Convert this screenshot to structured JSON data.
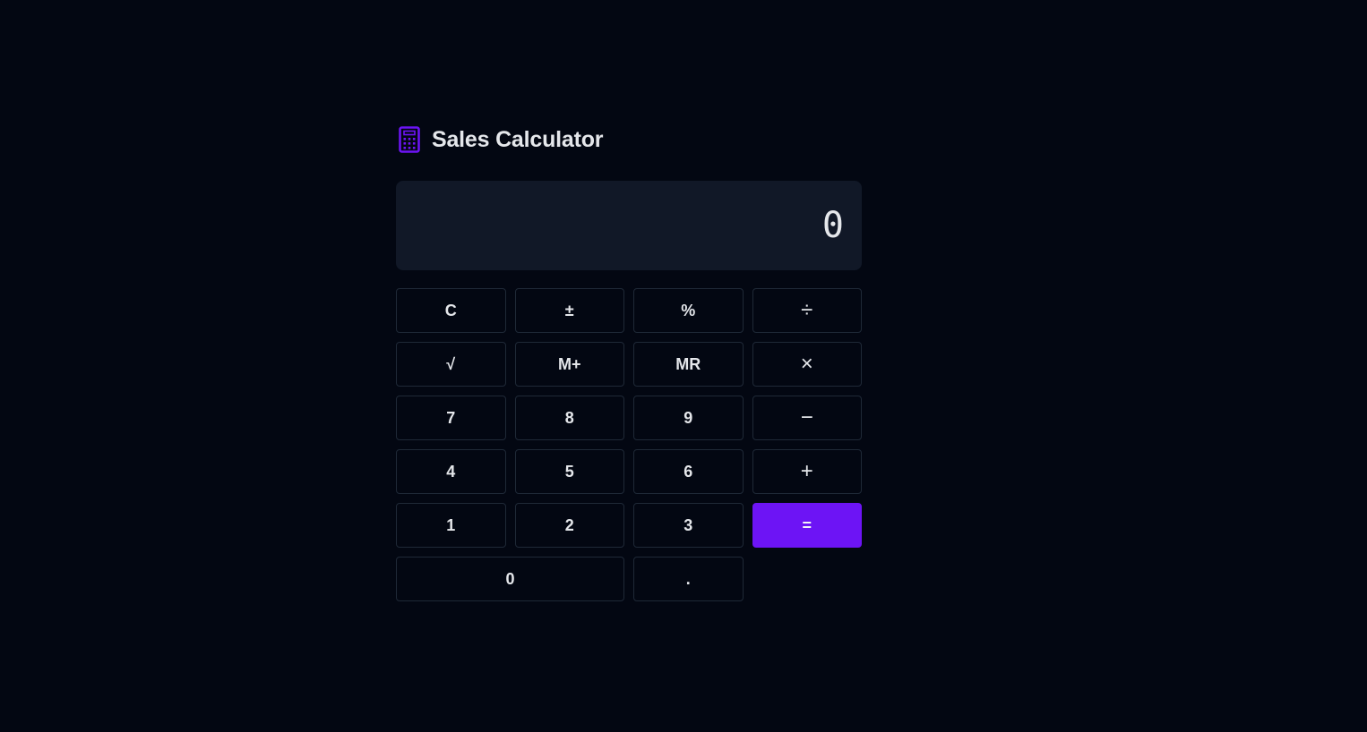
{
  "header": {
    "icon": "calculator-icon",
    "title": "Sales Calculator"
  },
  "display": {
    "value": "0"
  },
  "keys": {
    "clear": "C",
    "plus_minus": "±",
    "percent": "%",
    "divide": "÷",
    "sqrt": "√",
    "memory_add": "M+",
    "memory_recall": "MR",
    "multiply": "×",
    "seven": "7",
    "eight": "8",
    "nine": "9",
    "subtract": "−",
    "four": "4",
    "five": "5",
    "six": "6",
    "add": "+",
    "one": "1",
    "two": "2",
    "three": "3",
    "equals": "=",
    "zero": "0",
    "decimal": "."
  },
  "colors": {
    "background": "#030712",
    "display_bg": "#111827",
    "accent": "#6d14f5",
    "text": "#e5e7eb",
    "key_border": "#1f2937"
  }
}
